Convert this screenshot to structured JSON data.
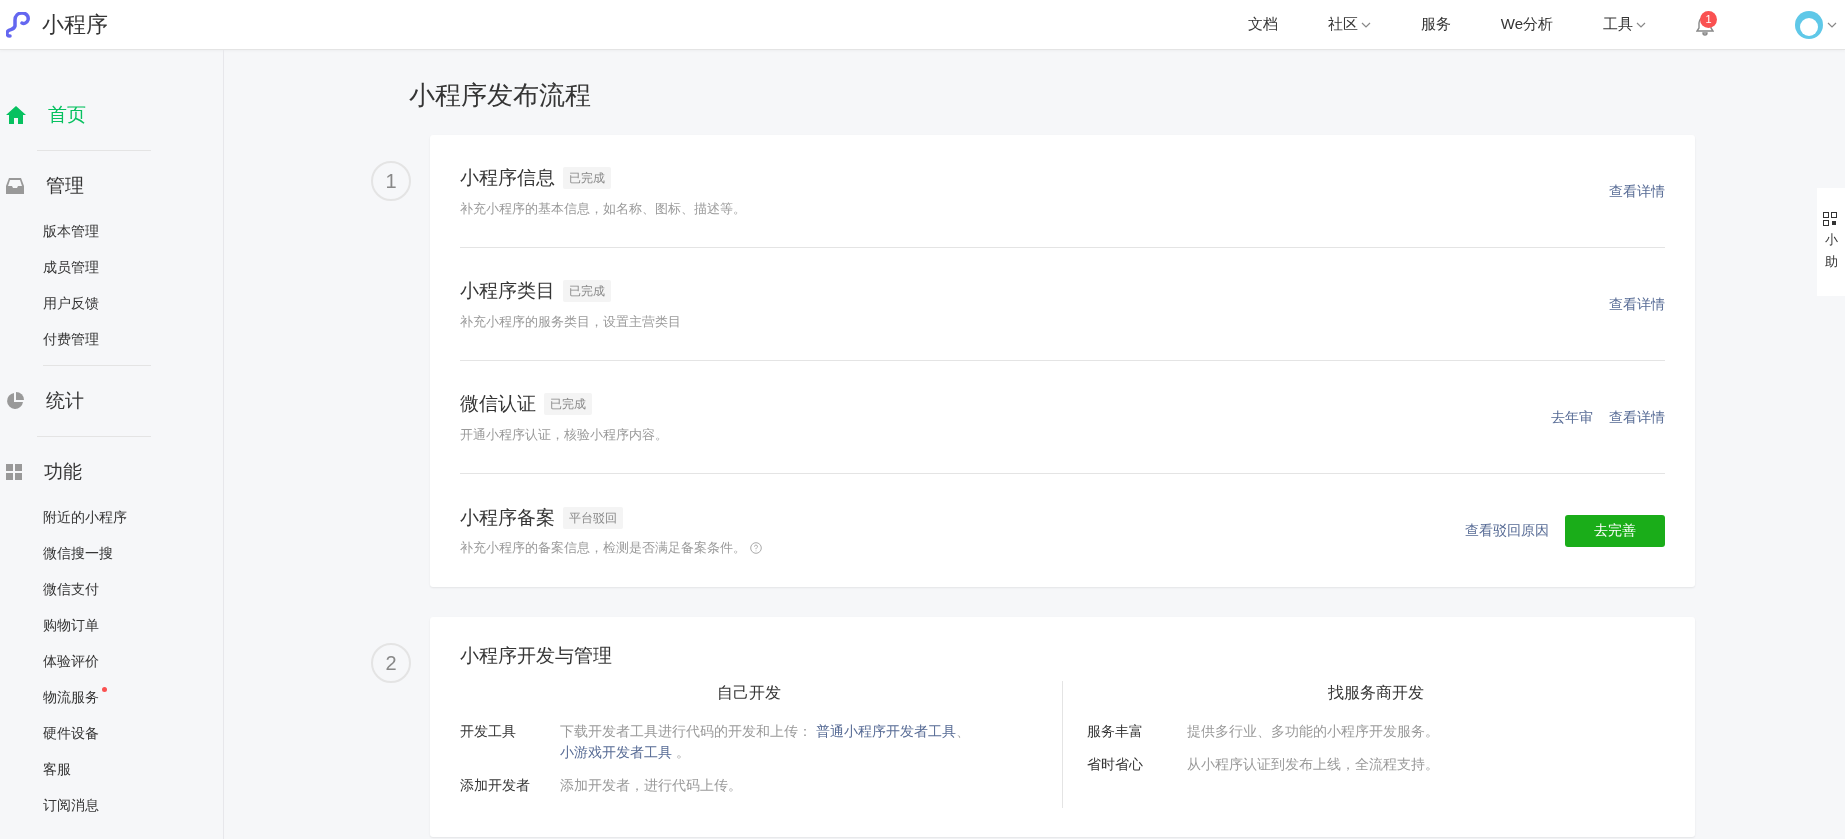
{
  "header": {
    "logo_text": "小程序",
    "nav": [
      {
        "label": "文档",
        "dropdown": false
      },
      {
        "label": "社区",
        "dropdown": true
      },
      {
        "label": "服务",
        "dropdown": false
      },
      {
        "label": "We分析",
        "dropdown": false
      },
      {
        "label": "工具",
        "dropdown": true
      }
    ],
    "notifications": "1"
  },
  "sidebar": [
    {
      "label": "首页",
      "selected": true
    },
    {
      "label": "管理",
      "selected": false,
      "children": [
        {
          "label": "版本管理",
          "dot": false
        },
        {
          "label": "成员管理",
          "dot": false
        },
        {
          "label": "用户反馈",
          "dot": false
        },
        {
          "label": "付费管理",
          "dot": false
        }
      ]
    },
    {
      "label": "统计",
      "selected": false
    },
    {
      "label": "功能",
      "selected": false,
      "children": [
        {
          "label": "附近的小程序",
          "dot": false
        },
        {
          "label": "微信搜一搜",
          "dot": false
        },
        {
          "label": "微信支付",
          "dot": false
        },
        {
          "label": "购物订单",
          "dot": false
        },
        {
          "label": "体验评价",
          "dot": false
        },
        {
          "label": "物流服务",
          "dot": true
        },
        {
          "label": "硬件设备",
          "dot": false
        },
        {
          "label": "客服",
          "dot": false
        },
        {
          "label": "订阅消息",
          "dot": false
        }
      ]
    }
  ],
  "page_title": "小程序发布流程",
  "step1": {
    "number": "1",
    "items": [
      {
        "title": "小程序信息",
        "tag": "已完成",
        "desc": "补充小程序的基本信息，如名称、图标、描述等。",
        "help": false,
        "actions": [
          {
            "kind": "link",
            "label": "查看详情"
          }
        ]
      },
      {
        "title": "小程序类目",
        "tag": "已完成",
        "desc": "补充小程序的服务类目，设置主营类目",
        "help": false,
        "actions": [
          {
            "kind": "link",
            "label": "查看详情"
          }
        ]
      },
      {
        "title": "微信认证",
        "tag": "已完成",
        "desc": "开通小程序认证，核验小程序内容。",
        "help": false,
        "actions": [
          {
            "kind": "link",
            "label": "去年审"
          },
          {
            "kind": "link",
            "label": "查看详情"
          }
        ]
      },
      {
        "title": "小程序备案",
        "tag": "平台驳回",
        "desc": "补充小程序的备案信息，检测是否满足备案条件。",
        "help": true,
        "actions": [
          {
            "kind": "link",
            "label": "查看驳回原因"
          },
          {
            "kind": "button",
            "label": "去完善"
          }
        ]
      }
    ]
  },
  "step2": {
    "number": "2",
    "title": "小程序开发与管理",
    "columns": [
      {
        "heading": "自己开发",
        "rows": [
          {
            "label": "开发工具",
            "text": "下载开发者工具进行代码的开发和上传：",
            "links": [
              "普通小程序开发者工具",
              "小游戏开发者工具"
            ],
            "link_sep": "、",
            "tail": "。"
          },
          {
            "label": "添加开发者",
            "text": "添加开发者，进行代码上传。",
            "links": [],
            "link_sep": "",
            "tail": ""
          }
        ]
      },
      {
        "heading": "找服务商开发",
        "rows": [
          {
            "label": "服务丰富",
            "text": "提供多行业、多功能的小程序开发服务。",
            "links": [],
            "link_sep": "",
            "tail": ""
          },
          {
            "label": "省时省心",
            "text": "从小程序认证到发布上线，全流程支持。",
            "links": [],
            "link_sep": "",
            "tail": ""
          }
        ]
      }
    ]
  },
  "side_widget": {
    "lines": [
      "小",
      "助"
    ]
  }
}
